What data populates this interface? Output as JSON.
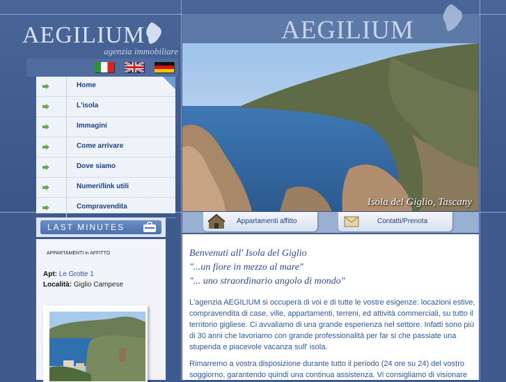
{
  "brand": {
    "name": "AEGILIUM",
    "tagline": "agenzia immobiliare"
  },
  "banner": {
    "name": "AEGILIUM"
  },
  "photo": {
    "caption": "Isola del Giglio, Tascany"
  },
  "flags": [
    "italian-flag",
    "uk-flag",
    "german-flag"
  ],
  "nav": {
    "items": [
      {
        "label": "Home"
      },
      {
        "label": "L'isola"
      },
      {
        "label": "Immagini"
      },
      {
        "label": "Come arrivare"
      },
      {
        "label": "Dove siamo"
      },
      {
        "label": "Numeri/link utili"
      },
      {
        "label": "Compravendita"
      }
    ]
  },
  "tabs": {
    "apartments": "Appartamenti affitto",
    "contacts": "Contatti/Prenota"
  },
  "last_minutes": {
    "title": "LAST MINUTES",
    "type": "APPARTAMENTI in AFFITTO",
    "apt_label": "Apt:",
    "apt_value": "Le Grotte 1",
    "loc_label": "Località:",
    "loc_value": "Giglio Campese"
  },
  "content": {
    "title1": "Benvenuti all' Isola del Giglio",
    "title2": "\"...un fiore in mezzo al mare\"",
    "title3": "\"... uno straordinario angolo di mondo\"",
    "para1": "L'agenzia AEGILIUM si occuperà di voi e di tutte le vostre esigenze: locazioni estive, compravendita di case, ville, appartamenti, terreni, ed attività commerciali, su tutto il territorio gigliese. Ci avvaliamo di una grande esperienza nel settore. Infatti sono più di 30 anni che lavoriamo con grande professionalità per far si che passiate una stupenda e piacevole vacanza sull' isola.",
    "para2": "Rimarremo a vostra disposizione durante tutto il periodo (24 ore su 24) del vostro soggiorno, garantendo quindi una continua assistenza. Vi consigliamo di visionare"
  },
  "colors": {
    "link": "#2b57a8",
    "nav_text": "#1c3f86",
    "background": "#3f5b8e"
  }
}
